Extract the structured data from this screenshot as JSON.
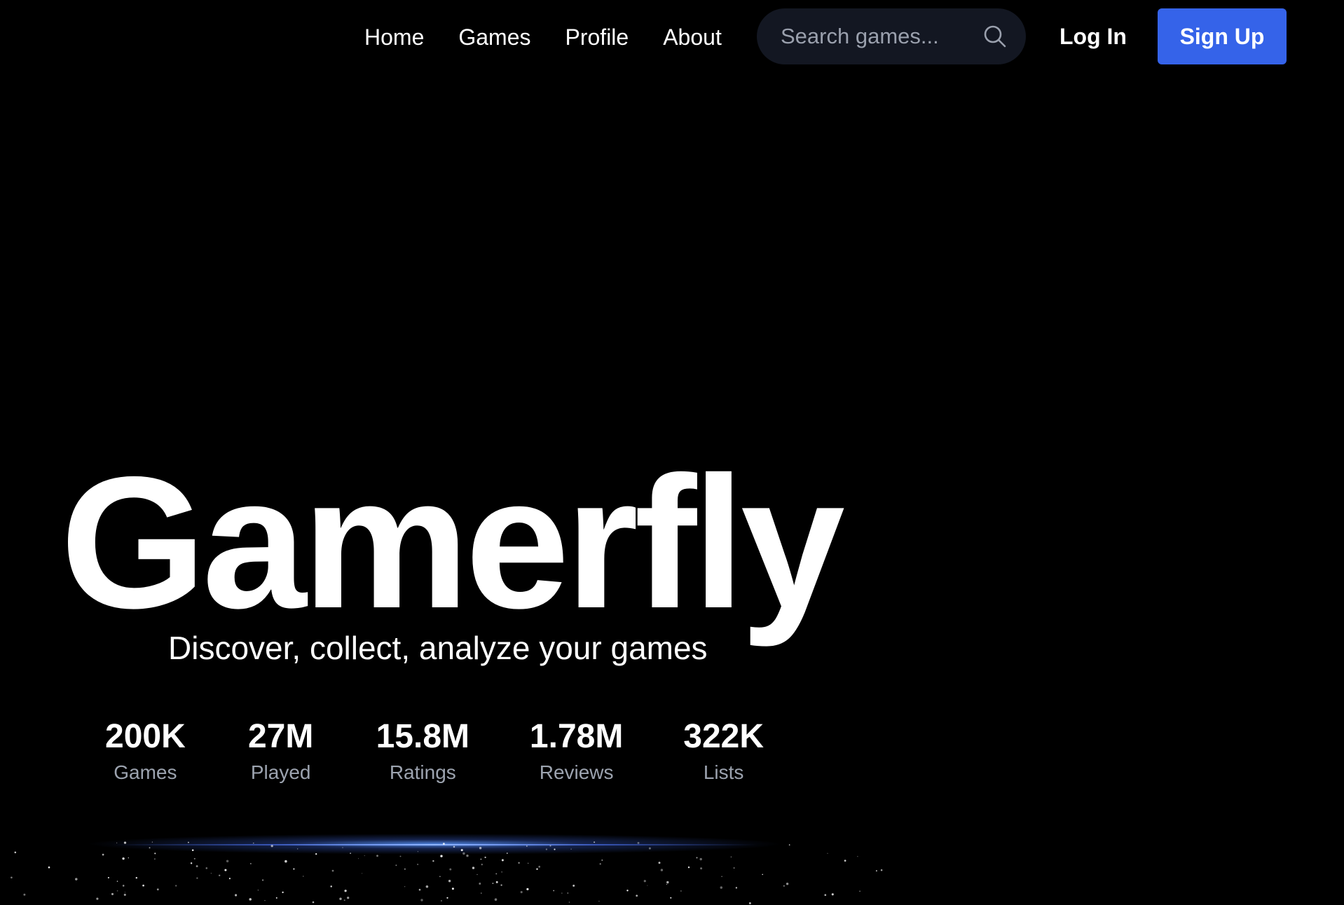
{
  "nav": {
    "links": [
      "Home",
      "Games",
      "Profile",
      "About"
    ]
  },
  "search": {
    "placeholder": "Search games...",
    "value": ""
  },
  "auth": {
    "login_label": "Log In",
    "signup_label": "Sign Up"
  },
  "hero": {
    "title": "Gamerfly",
    "tagline": "Discover, collect, analyze your games"
  },
  "stats": [
    {
      "value": "200K",
      "label": "Games"
    },
    {
      "value": "27M",
      "label": "Played"
    },
    {
      "value": "15.8M",
      "label": "Ratings"
    },
    {
      "value": "1.78M",
      "label": "Reviews"
    },
    {
      "value": "322K",
      "label": "Lists"
    }
  ],
  "colors": {
    "background": "#000000",
    "accent": "#3563e9",
    "search_bg": "#131722",
    "muted_text": "#9ca3af",
    "glow": "#8fb4ff"
  },
  "icons": {
    "search": "search-icon"
  }
}
